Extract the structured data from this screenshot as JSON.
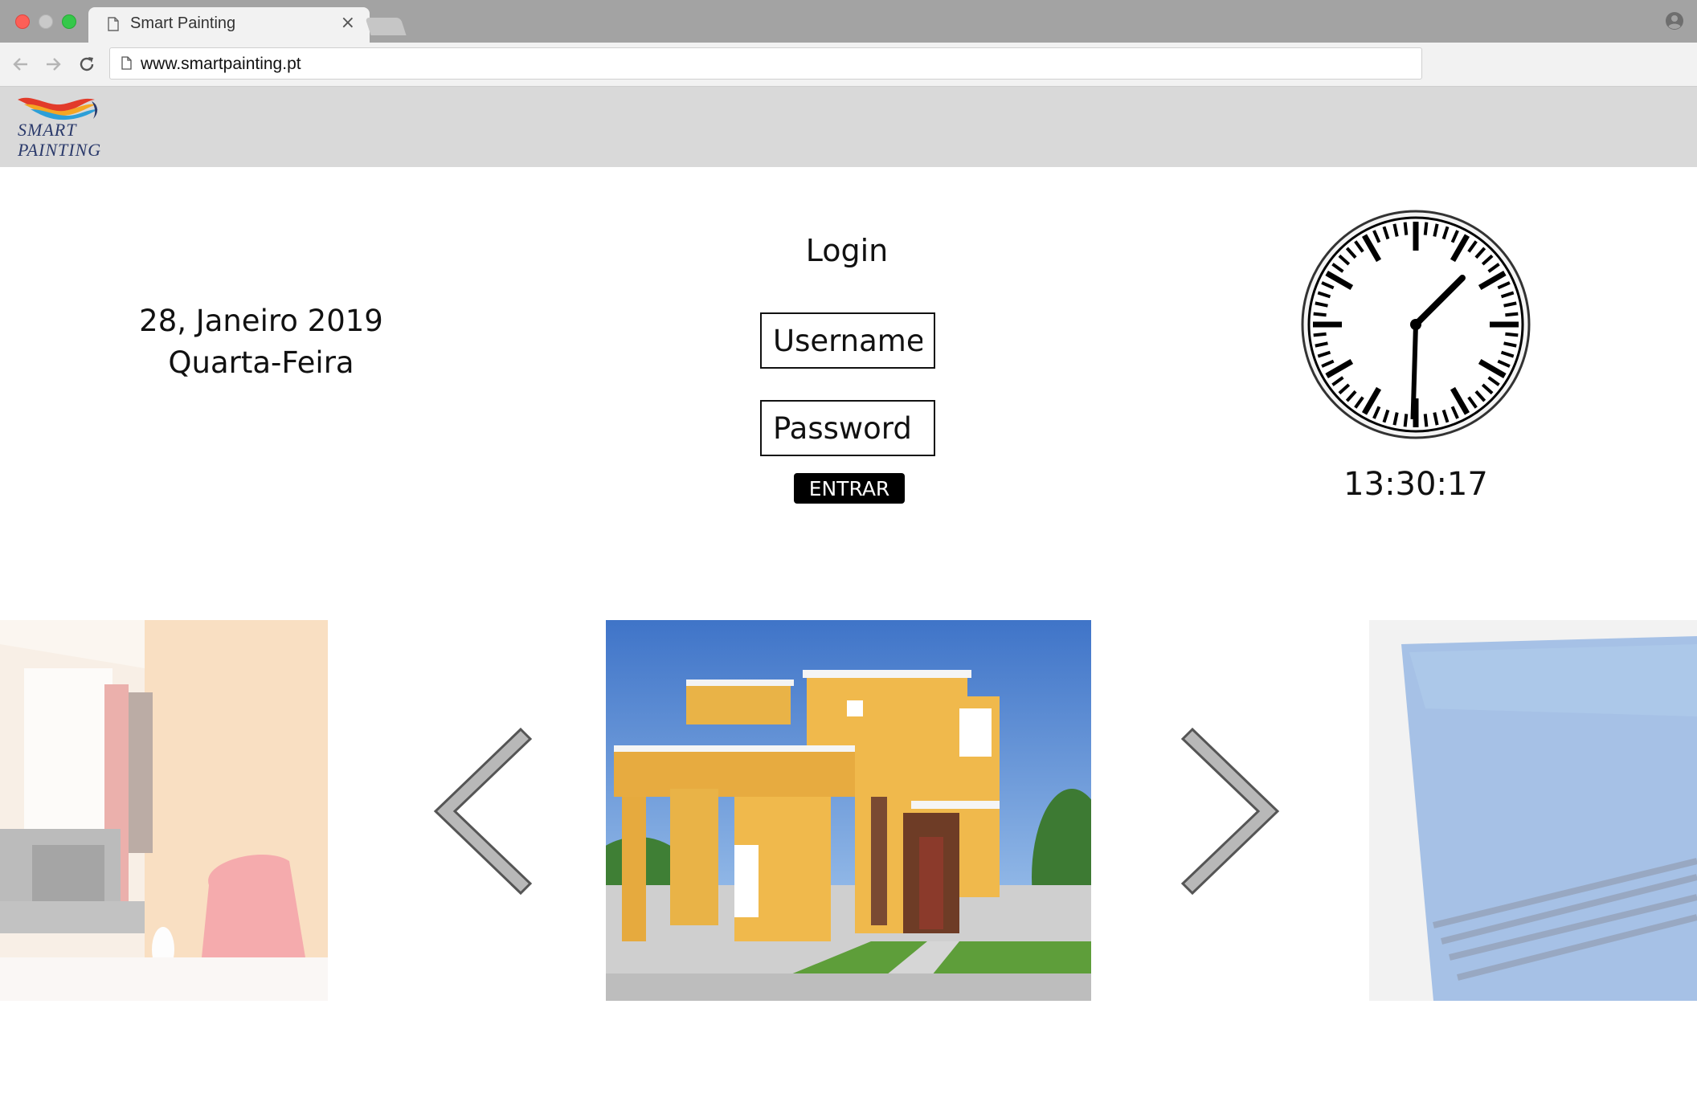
{
  "browser": {
    "tab_title": "Smart Painting",
    "tab_close": "×",
    "url": "www.smartpainting.pt"
  },
  "logo": {
    "line1": "SMART",
    "line2": "PAINTING"
  },
  "date": {
    "line1": "28, Janeiro 2019",
    "line2": "Quarta-Feira"
  },
  "login": {
    "title": "Login",
    "username_placeholder": "Username",
    "password_placeholder": "Password",
    "submit_label": "ENTRAR"
  },
  "clock": {
    "time": "13:30:17",
    "hour": 13,
    "minute": 30,
    "second": 17
  },
  "carousel": {
    "slides": [
      "living room with orange wall",
      "yellow two-story house",
      "blue swimming pool"
    ],
    "prev_icon": "chevron-left-icon",
    "next_icon": "chevron-right-icon"
  },
  "colors": {
    "titlebar": "#a3a3a3",
    "toolbar": "#f2f2f2",
    "site_header": "#d9d9d9",
    "button_bg": "#000000",
    "arrow_fill": "#b8b8b8"
  }
}
